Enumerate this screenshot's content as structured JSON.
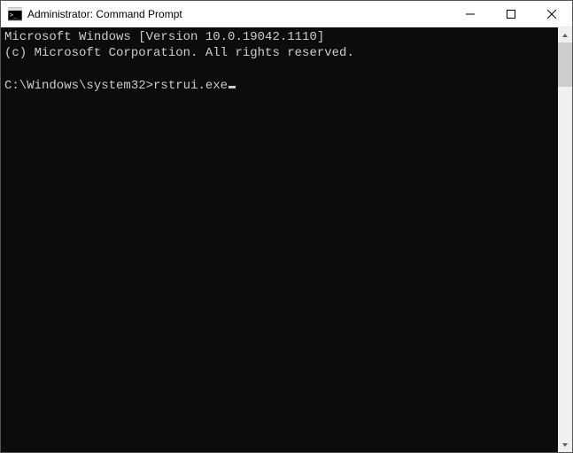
{
  "window": {
    "title": "Administrator: Command Prompt"
  },
  "terminal": {
    "line1": "Microsoft Windows [Version 10.0.19042.1110]",
    "line2": "(c) Microsoft Corporation. All rights reserved.",
    "prompt": "C:\\Windows\\system32>",
    "command": "rstrui.exe"
  }
}
